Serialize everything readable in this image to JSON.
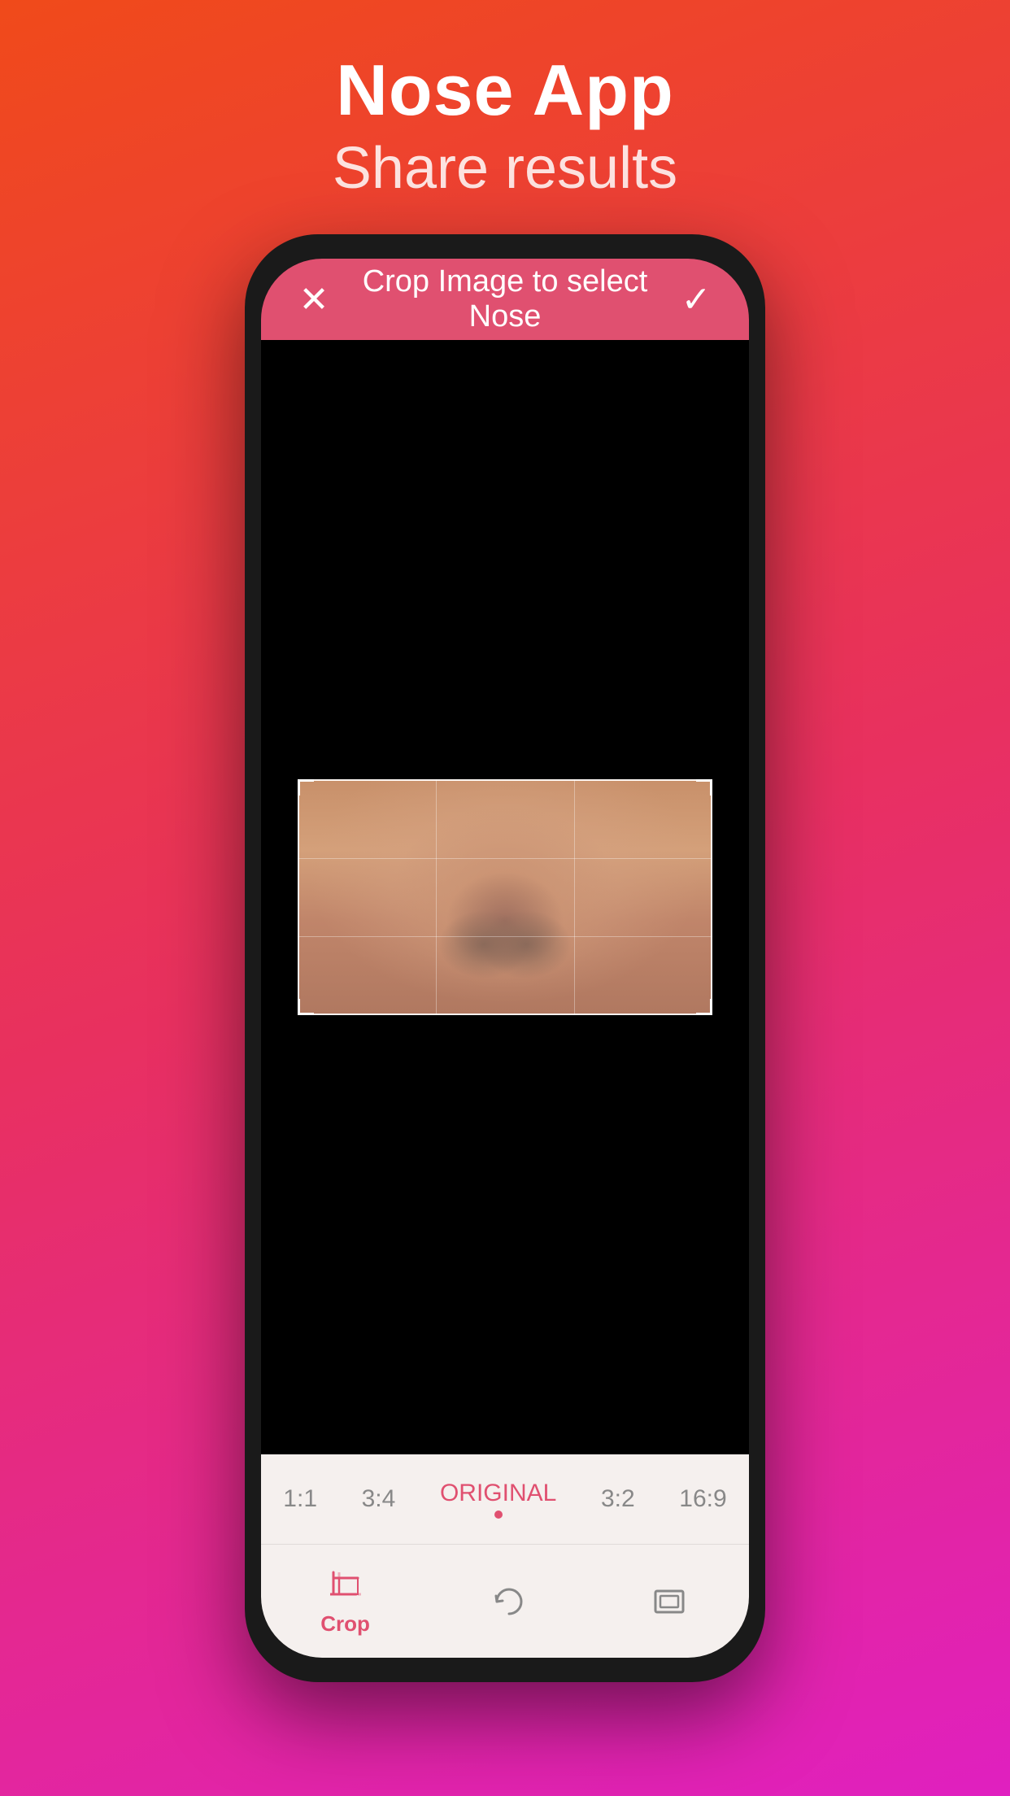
{
  "header": {
    "title": "Nose App",
    "subtitle": "Share results"
  },
  "top_bar": {
    "title": "Crop Image to select Nose",
    "close_icon": "✕",
    "confirm_icon": "✓"
  },
  "ratio_bar": {
    "options": [
      {
        "label": "1:1",
        "active": false
      },
      {
        "label": "3:4",
        "active": false
      },
      {
        "label": "ORIGINAL",
        "active": true
      },
      {
        "label": "3:2",
        "active": false
      },
      {
        "label": "16:9",
        "active": false
      }
    ]
  },
  "toolbar": {
    "items": [
      {
        "label": "Crop",
        "icon": "crop",
        "active": true
      },
      {
        "label": "",
        "icon": "rotate",
        "active": false
      },
      {
        "label": "",
        "icon": "aspect",
        "active": false
      }
    ]
  },
  "colors": {
    "accent": "#e05070",
    "background_gradient_start": "#f04a1a",
    "background_gradient_mid": "#e83060",
    "background_gradient_end": "#e020c0",
    "phone_body": "#1a1a1a",
    "screen_bg": "#000000",
    "bottom_bar_bg": "#f5f0ee"
  }
}
